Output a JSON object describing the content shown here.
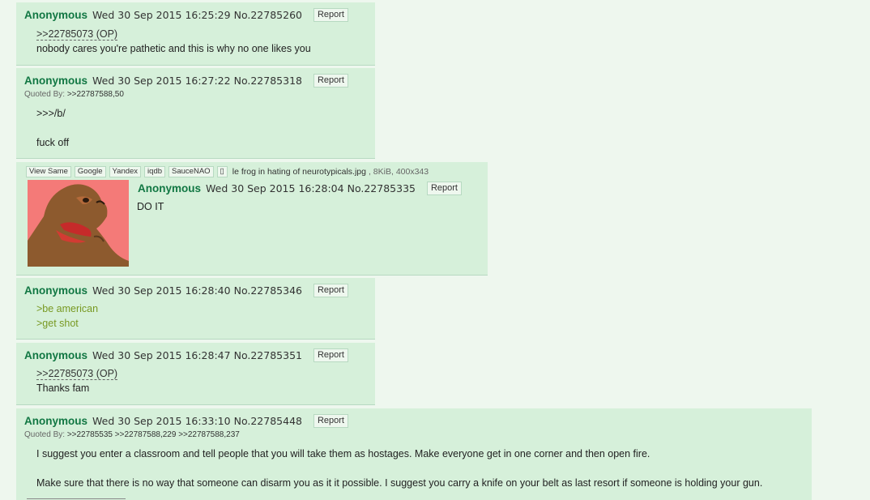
{
  "posts": [
    {
      "name": "Anonymous",
      "datetime": "Wed 30 Sep 2015 16:25:29",
      "number": "No.22785260",
      "report_label": "Report",
      "quote": ">>22785073 (OP)",
      "text": "nobody cares you're pathetic and this is why no one likes you"
    },
    {
      "name": "Anonymous",
      "datetime": "Wed 30 Sep 2015 16:27:22",
      "number": "No.22785318",
      "report_label": "Report",
      "quoted_by_label": "Quoted By:",
      "quoted_by": ">>22787588,50",
      "line1": ">>>/b/",
      "line2": "fuck off"
    },
    {
      "file_buttons": [
        "View Same",
        "Google",
        "Yandex",
        "iqdb",
        "SauceNAO",
        "▯"
      ],
      "file_name": "le frog in hating of neurotypicals.jpg",
      "file_meta": ", 8KiB, 400x343",
      "name": "Anonymous",
      "datetime": "Wed 30 Sep 2015 16:28:04",
      "number": "No.22785335",
      "report_label": "Report",
      "text": "DO IT"
    },
    {
      "name": "Anonymous",
      "datetime": "Wed 30 Sep 2015 16:28:40",
      "number": "No.22785346",
      "report_label": "Report",
      "green1": ">be american",
      "green2": ">get shot"
    },
    {
      "name": "Anonymous",
      "datetime": "Wed 30 Sep 2015 16:28:47",
      "number": "No.22785351",
      "report_label": "Report",
      "quote": ">>22785073 (OP)",
      "text": "Thanks fam"
    },
    {
      "name": "Anonymous",
      "datetime": "Wed 30 Sep 2015 16:33:10",
      "number": "No.22785448",
      "report_label": "Report",
      "quoted_by_label": "Quoted By:",
      "quoted_by_links": [
        ">>22785535",
        ">>22787588,229",
        ">>22787588,237"
      ],
      "line1": "I suggest you enter a classroom and tell people that you will take them as hostages. Make everyone get in one corner and then open fire.",
      "line2": "Make sure that there is no way that someone can disarm you as it it possible. I suggest you carry a knife on your belt as last resort if someone is holding your gun."
    }
  ],
  "colors": {
    "page_bg": "#eef7ee",
    "post_bg": "#d6f0da",
    "name": "#117743",
    "greentext": "#789922"
  }
}
